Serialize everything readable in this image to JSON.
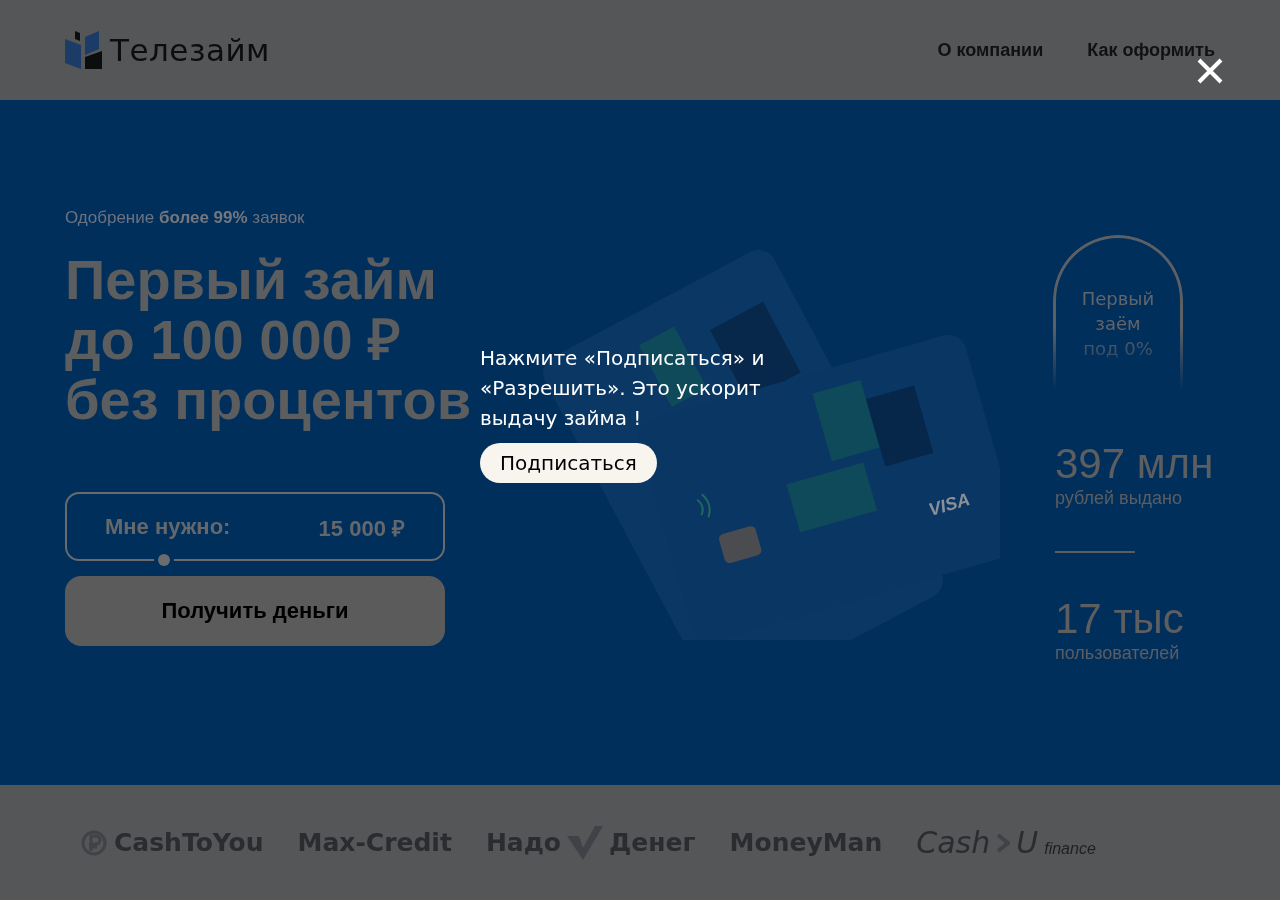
{
  "header": {
    "logo": "Телезайм",
    "nav": [
      "О компании",
      "Как оформить"
    ]
  },
  "hero": {
    "approval": "Одобрение **более 99%** заявок",
    "headline": [
      "Первый займ",
      "до 100 000 ₽",
      "без процентов"
    ],
    "amount": {
      "label": "Мне нужно:",
      "value": "15 000 ₽",
      "level": 0.26
    },
    "cta": "Получить деньги",
    "card_brand": "VISA",
    "badge": "Первый заём под 0%",
    "stats": [
      {
        "value": "397 млн",
        "label": "рублей выдано"
      },
      {
        "value": "17 тыс",
        "label": "пользователей"
      }
    ]
  },
  "partners": [
    {
      "text": "CashToYou",
      "kind": "coin"
    },
    {
      "text": "Max-Credit",
      "kind": "plain"
    },
    {
      "text": "Надо",
      "text2": "Денег",
      "kind": "check"
    },
    {
      "text": "MoneyMan",
      "kind": "plain"
    },
    {
      "text": "Cash",
      "text2": "U",
      "sub": "finance",
      "kind": "chevron"
    }
  ],
  "popup": {
    "message": "Нажмите «Подписаться» и «Разрешить». Это ускорит выдачу займа !",
    "button": "Подписаться"
  }
}
